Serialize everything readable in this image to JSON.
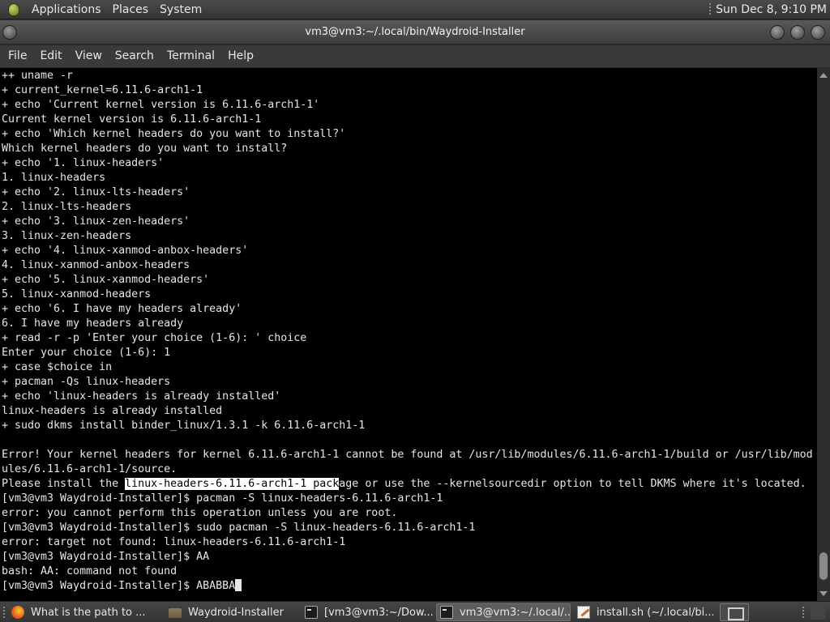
{
  "top_panel": {
    "menus": [
      "Applications",
      "Places",
      "System"
    ],
    "clock": "Sun Dec  8,  9:10 PM"
  },
  "window": {
    "title": "vm3@vm3:~/.local/bin/Waydroid-Installer"
  },
  "menubar": {
    "items": [
      "File",
      "Edit",
      "View",
      "Search",
      "Terminal",
      "Help"
    ]
  },
  "terminal": {
    "lines": [
      "++ uname -r",
      "+ current_kernel=6.11.6-arch1-1",
      "+ echo 'Current kernel version is 6.11.6-arch1-1'",
      "Current kernel version is 6.11.6-arch1-1",
      "+ echo 'Which kernel headers do you want to install?'",
      "Which kernel headers do you want to install?",
      "+ echo '1. linux-headers'",
      "1. linux-headers",
      "+ echo '2. linux-lts-headers'",
      "2. linux-lts-headers",
      "+ echo '3. linux-zen-headers'",
      "3. linux-zen-headers",
      "+ echo '4. linux-xanmod-anbox-headers'",
      "4. linux-xanmod-anbox-headers",
      "+ echo '5. linux-xanmod-headers'",
      "5. linux-xanmod-headers",
      "+ echo '6. I have my headers already'",
      "6. I have my headers already",
      "+ read -r -p 'Enter your choice (1-6): ' choice",
      "Enter your choice (1-6): 1",
      "+ case $choice in",
      "+ pacman -Qs linux-headers",
      "+ echo 'linux-headers is already installed'",
      "linux-headers is already installed",
      "+ sudo dkms install binder_linux/1.3.1 -k 6.11.6-arch1-1",
      "",
      "Error! Your kernel headers for kernel 6.11.6-arch1-1 cannot be found at /usr/lib/modules/6.11.6-arch1-1/build or /usr/lib/mod",
      "ules/6.11.6-arch1-1/source."
    ],
    "selection_line": {
      "before": "Please install the ",
      "selected": "linux-headers-6.11.6-arch1-1 pack",
      "after": "age or use the --kernelsourcedir option to tell DKMS where it's located."
    },
    "lines_after": [
      "[vm3@vm3 Waydroid-Installer]$ pacman -S linux-headers-6.11.6-arch1-1",
      "error: you cannot perform this operation unless you are root.",
      "[vm3@vm3 Waydroid-Installer]$ sudo pacman -S linux-headers-6.11.6-arch1-1",
      "error: target not found: linux-headers-6.11.6-arch1-1",
      "[vm3@vm3 Waydroid-Installer]$ AA",
      "bash: AA: command not found"
    ],
    "prompt_line": "[vm3@vm3 Waydroid-Installer]$ ABABBA"
  },
  "taskbar": {
    "tasks": [
      {
        "label": "What is the path to ...",
        "icon": "firefox-icon"
      },
      {
        "label": "Waydroid-Installer",
        "icon": "folder-icon"
      },
      {
        "label": "[vm3@vm3:~/Dow...",
        "icon": "terminal-icon"
      },
      {
        "label": "vm3@vm3:~/.local/...",
        "icon": "terminal-icon"
      },
      {
        "label": "install.sh (~/.local/bi...",
        "icon": "text-editor-icon"
      }
    ]
  },
  "colors": {
    "terminal_bg": "#000000",
    "terminal_fg": "#e6e6e6",
    "selection_bg": "#ffffff",
    "panel_bg": "#3a3a3a"
  }
}
